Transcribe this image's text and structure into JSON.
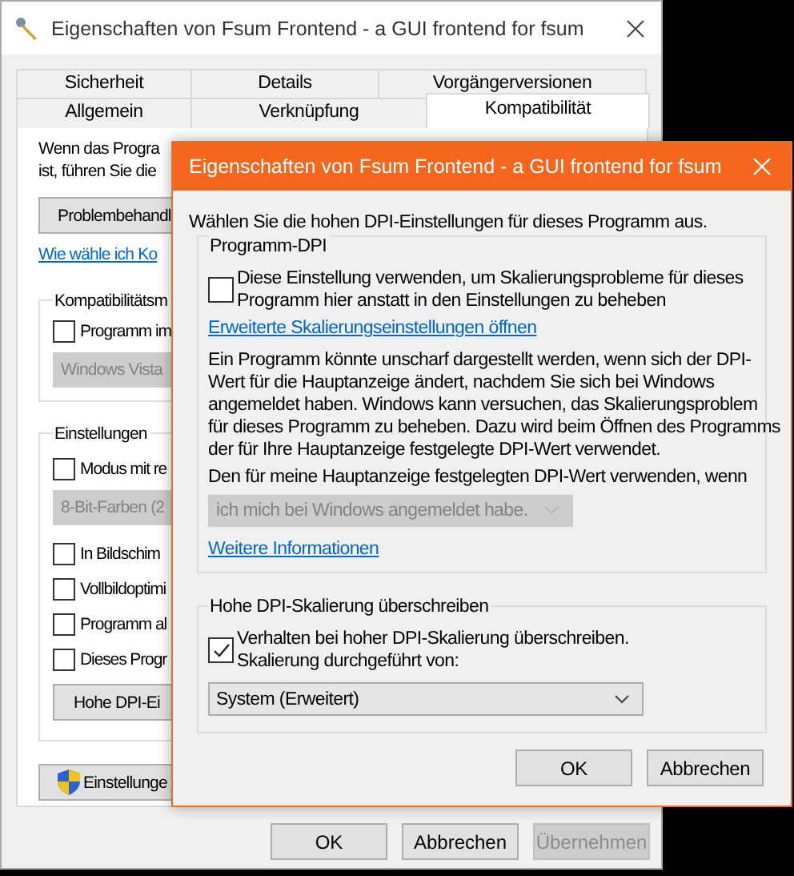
{
  "back_window": {
    "title": "Eigenschaften von Fsum Frontend - a GUI frontend for fsum",
    "tab_rows": [
      [
        {
          "label": "Sicherheit",
          "selected": false
        },
        {
          "label": "Details",
          "selected": false
        },
        {
          "label": "Vorgängerversionen",
          "selected": false
        }
      ],
      [
        {
          "label": "Allgemein",
          "selected": false
        },
        {
          "label": "Verknüpfung",
          "selected": false
        },
        {
          "label": "Kompatibilität",
          "selected": true
        }
      ]
    ],
    "intro_lines": [
      "Wenn das Progra",
      "ist, führen Sie die"
    ],
    "troubleshoot_button": "Problembehandl",
    "help_link": "Wie wähle ich Ko",
    "compat_group": {
      "label": "Kompatibilitätsm",
      "checkbox": {
        "label": "Programm im",
        "checked": false
      },
      "dropdown": {
        "value": "Windows Vista",
        "disabled": true
      }
    },
    "settings_group": {
      "label": "Einstellungen",
      "items": [
        {
          "kind": "checkbox",
          "label": "Modus mit re",
          "checked": false
        },
        {
          "kind": "dropdown",
          "value": "8-Bit-Farben (2",
          "disabled": true
        },
        {
          "kind": "checkbox",
          "label": "In Bildschim",
          "checked": false
        },
        {
          "kind": "checkbox",
          "label": "Vollbildoptimi",
          "checked": false
        },
        {
          "kind": "checkbox",
          "label": "Programm al",
          "checked": false
        },
        {
          "kind": "checkbox",
          "label": "Dieses Progr",
          "checked": false
        },
        {
          "kind": "button",
          "label": "Hohe DPI-Ei"
        }
      ]
    },
    "admin_button": "Einstellunge",
    "buttons": [
      {
        "label": "OK",
        "disabled": false
      },
      {
        "label": "Abbrechen",
        "disabled": false
      },
      {
        "label": "Übernehmen",
        "disabled": true
      }
    ]
  },
  "dialog": {
    "title": "Eigenschaften von Fsum Frontend - a GUI frontend for fsum",
    "instruction": "Wählen Sie die hohen DPI-Einstellungen für dieses Programm aus.",
    "program_dpi_group": {
      "label": "Programm-DPI",
      "checkbox": {
        "label": "Diese Einstellung verwenden, um Skalierungsprobleme für dieses Programm hier anstatt in den Einstellungen zu beheben",
        "checked": false
      },
      "link": "Erweiterte Skalierungseinstellungen öffnen",
      "description": "Ein Programm könnte unscharf dargestellt werden, wenn sich der DPI-Wert für die Hauptanzeige ändert, nachdem Sie sich bei Windows angemeldet haben. Windows kann versuchen, das Skalierungsproblem für dieses Programm zu beheben. Dazu wird beim Öffnen des Programms der für Ihre Hauptanzeige festgelegte DPI-Wert verwendet.",
      "condition_label": "Den für meine Hauptanzeige festgelegten DPI-Wert verwenden, wenn",
      "dropdown": {
        "value": "ich mich bei Windows angemeldet habe.",
        "disabled": true
      },
      "more_link": "Weitere Informationen"
    },
    "override_group": {
      "label": "Hohe DPI-Skalierung überschreiben",
      "checkbox": {
        "label": "Verhalten bei hoher DPI-Skalierung überschreiben. Skalierung durchgeführt von:",
        "checked": true
      },
      "dropdown": {
        "value": "System (Erweitert)",
        "disabled": false
      }
    },
    "buttons": [
      {
        "label": "OK",
        "disabled": false
      },
      {
        "label": "Abbrechen",
        "disabled": false
      }
    ]
  }
}
